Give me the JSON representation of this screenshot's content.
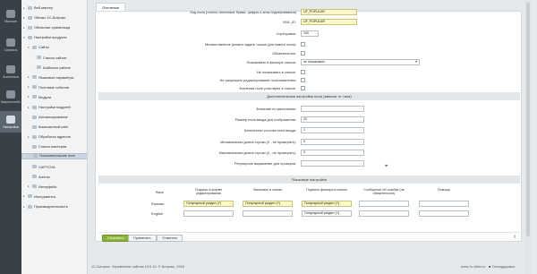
{
  "rail": [
    {
      "label": "Магазин",
      "active": false
    },
    {
      "label": "Сервисы",
      "active": false
    },
    {
      "label": "Аналитика",
      "active": false
    },
    {
      "label": "Маркетплейс",
      "active": false
    },
    {
      "label": "Настройки",
      "active": true
    }
  ],
  "tree": [
    {
      "label": "Веб-мастер",
      "expanded": false,
      "level": 0
    },
    {
      "label": "Облако 1С-Битрикс",
      "expanded": false,
      "level": 0
    },
    {
      "label": "Облачные хранилища",
      "expanded": false,
      "level": 0
    },
    {
      "label": "Настройки продукта",
      "expanded": true,
      "level": 0
    },
    {
      "label": "Сайты",
      "expanded": true,
      "level": 1
    },
    {
      "label": "Список сайтов",
      "expanded": null,
      "level": 2
    },
    {
      "label": "Шаблоны сайтов",
      "expanded": null,
      "level": 2
    },
    {
      "label": "Языковые параметры",
      "expanded": false,
      "level": 1
    },
    {
      "label": "Почтовые события",
      "expanded": false,
      "level": 1
    },
    {
      "label": "Модули",
      "expanded": false,
      "level": 1
    },
    {
      "label": "Настройки модулей",
      "expanded": false,
      "level": 1
    },
    {
      "label": "Автокеширование",
      "expanded": null,
      "level": 1
    },
    {
      "label": "Композитный сайт",
      "expanded": null,
      "level": 1
    },
    {
      "label": "Обработка адресов",
      "expanded": false,
      "level": 1
    },
    {
      "label": "Список мастеров",
      "expanded": null,
      "level": 1
    },
    {
      "label": "Пользовательские поля",
      "expanded": null,
      "level": 1,
      "selected": true
    },
    {
      "label": "CAPTCHA",
      "expanded": null,
      "level": 1
    },
    {
      "label": "Агенты",
      "expanded": null,
      "level": 1
    },
    {
      "label": "Интерфейс",
      "expanded": false,
      "level": 1
    },
    {
      "label": "Инструменты",
      "expanded": false,
      "level": 0
    },
    {
      "label": "Производительность",
      "expanded": false,
      "level": 0
    }
  ],
  "tab_label": "Основные",
  "top_partial_label": "Код поля (только латинские буквы, цифры и знак подчеркивания)",
  "top_partial_value": "UF_POPULAR",
  "fields": [
    {
      "label": "XML_ID:",
      "type": "input",
      "value": "UF_POPULAR",
      "yellow": true,
      "w": 63
    },
    {
      "label": "Сортировка:",
      "type": "input",
      "value": "100",
      "yellow": false,
      "w": 20
    },
    {
      "label": "Множественное (можно задать только для нового поля):",
      "type": "check"
    },
    {
      "label": "Обязательное:",
      "type": "check"
    },
    {
      "label": "Показывать в фильтре списка:",
      "type": "select",
      "value": "не показывать"
    },
    {
      "label": "Не показывать в списке:",
      "type": "check"
    },
    {
      "label": "Не разрешать редактирование пользователем:",
      "type": "check"
    },
    {
      "label": "Значения поля участвуют в поиске:",
      "type": "check"
    }
  ],
  "section_extra": "Дополнительные настройки поля (зависят от типа)",
  "extra_fields": [
    {
      "label": "Значение по умолчанию:",
      "value": "",
      "w": 71
    },
    {
      "label": "Размер поля ввода для отображения:",
      "value": "20",
      "w": 71
    },
    {
      "label": "Количество строчек поля ввода:",
      "value": "1",
      "w": 71
    },
    {
      "label": "Минимальная длина строки (0 - не проверять):",
      "value": "0",
      "w": 71
    },
    {
      "label": "Максимальная длина строки (0 - не проверять):",
      "value": "0",
      "w": 71
    },
    {
      "label": "Регулярное выражение для проверки:",
      "value": "",
      "w": 71
    }
  ],
  "section_lang": "Языковые настройки",
  "lang_headers": [
    "Язык",
    "Подпись в форме редактирования",
    "Заголовок в списке",
    "Подпись фильтра в списке",
    "Сообщение об ошибке (не обязательное)",
    "Помощь"
  ],
  "lang_rows": [
    {
      "lang": "Russian",
      "values": [
        "Популярный раздел (Y)",
        "Популярный раздел (Y)",
        "Популярный раздел (Y)",
        "",
        ""
      ]
    },
    {
      "lang": "English",
      "values": [
        "",
        "",
        "Популярный раздел (Y)",
        "",
        ""
      ]
    }
  ],
  "buttons": {
    "save": "Сохранить",
    "apply": "Применить",
    "cancel": "Отменить"
  },
  "bottom": {
    "copyright": "1С-Битрикс: Управление сайтом 15.5.10. © Битрикс, 2015",
    "site": "www.1c-bitrix.ru",
    "support": "Техподдержка"
  }
}
